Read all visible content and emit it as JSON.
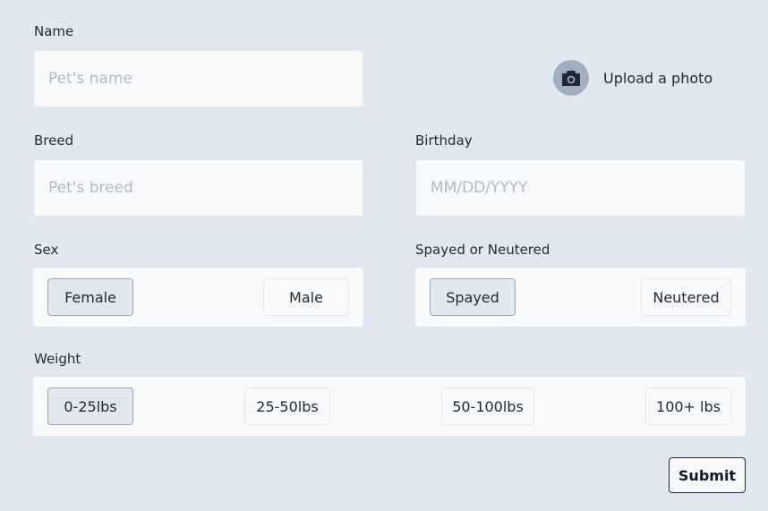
{
  "form": {
    "name": {
      "label": "Name",
      "placeholder": "Pet's name",
      "value": ""
    },
    "breed": {
      "label": "Breed",
      "placeholder": "Pet's breed",
      "value": ""
    },
    "birthday": {
      "label": "Birthday",
      "placeholder": "MM/DD/YYYY",
      "value": ""
    },
    "upload": {
      "label": "Upload a photo",
      "icon": "camera-icon"
    },
    "sex": {
      "label": "Sex",
      "options": [
        "Female",
        "Male"
      ],
      "selected": "Female"
    },
    "spayed": {
      "label": "Spayed or Neutered",
      "options": [
        "Spayed",
        "Neutered"
      ],
      "selected": "Spayed"
    },
    "weight": {
      "label": "Weight",
      "options": [
        "0-25lbs",
        "25-50lbs",
        "50-100lbs",
        "100+ lbs"
      ],
      "selected": "0-25lbs"
    },
    "submit_label": "Submit"
  },
  "colors": {
    "background": "#e2e8f0",
    "field": "#f8fafc",
    "selected": "#e2e8f0",
    "upload_circle": "#a0aec0",
    "text": "#1f2937"
  }
}
